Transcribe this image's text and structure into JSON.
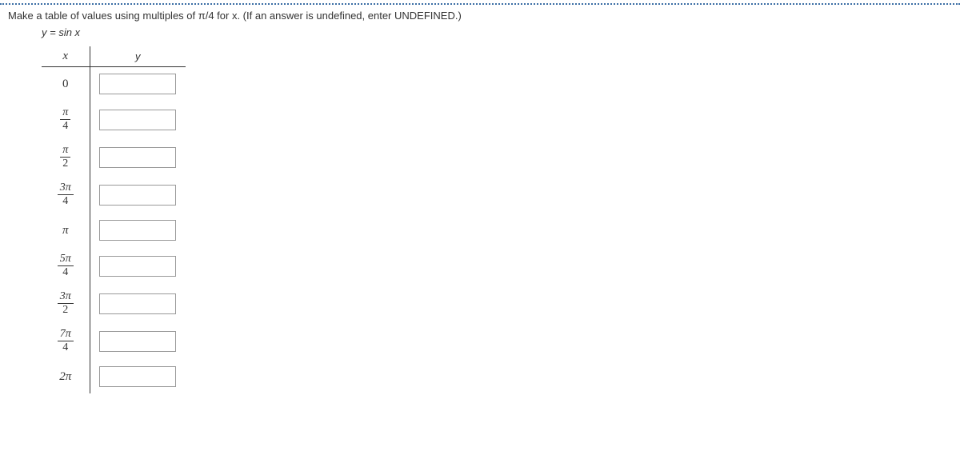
{
  "question": "Make a table of values using multiples of π/4 for x. (If an answer is undefined, enter UNDEFINED.)",
  "equation": "y = sin x",
  "headers": {
    "x": "x",
    "y": "y"
  },
  "rows": [
    {
      "type": "plain",
      "label": "0",
      "value": ""
    },
    {
      "type": "frac",
      "num": "π",
      "den": "4",
      "value": ""
    },
    {
      "type": "frac",
      "num": "π",
      "den": "2",
      "value": ""
    },
    {
      "type": "frac",
      "num": "3π",
      "den": "4",
      "value": ""
    },
    {
      "type": "plain",
      "label": "π",
      "value": ""
    },
    {
      "type": "frac",
      "num": "5π",
      "den": "4",
      "value": ""
    },
    {
      "type": "frac",
      "num": "3π",
      "den": "2",
      "value": ""
    },
    {
      "type": "frac",
      "num": "7π",
      "den": "4",
      "value": ""
    },
    {
      "type": "plain",
      "label": "2π",
      "value": ""
    }
  ]
}
